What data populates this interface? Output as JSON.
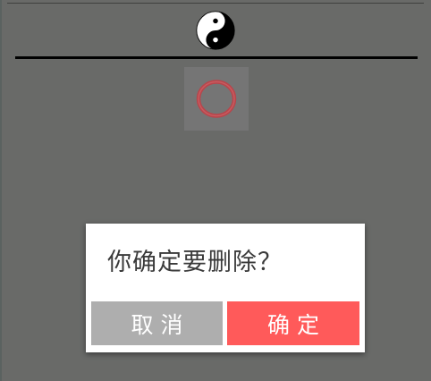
{
  "header": {
    "logo_icon": "yin-yang-icon"
  },
  "loader": {
    "icon": "loading-ring-icon",
    "color": "#b8454b"
  },
  "dialog": {
    "message": "你确定要删除？",
    "cancel_label": "取消",
    "confirm_label": "确定",
    "cancel_color": "#aeaeae",
    "confirm_color": "#ff5a5a"
  }
}
